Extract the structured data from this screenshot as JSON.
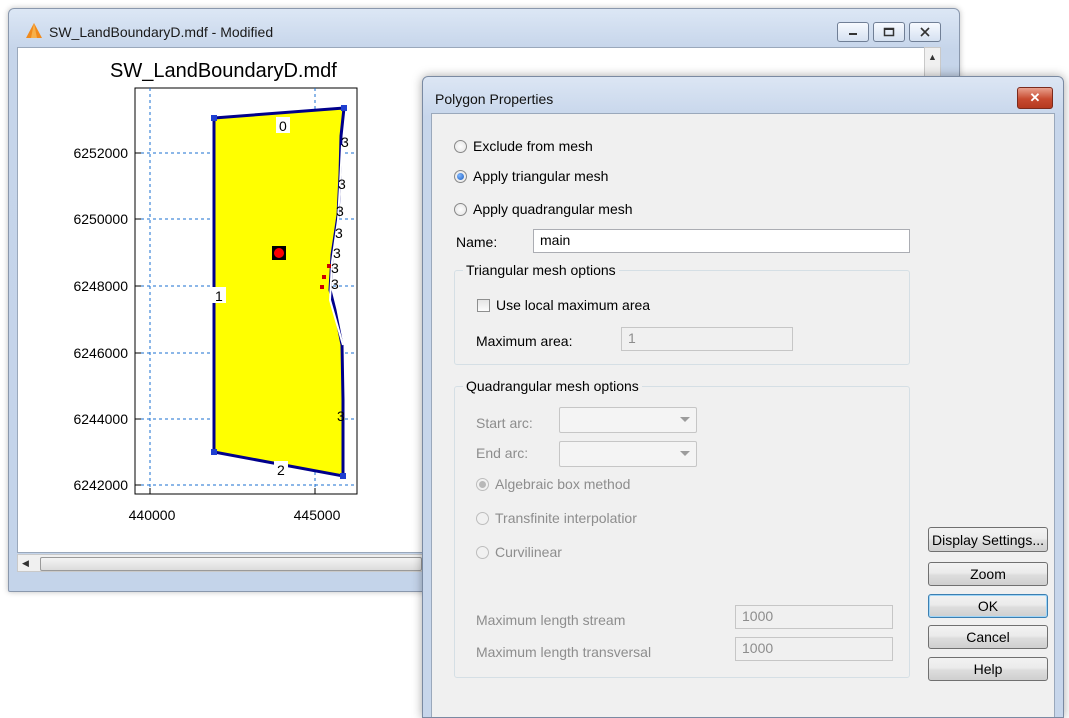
{
  "main_window": {
    "title": "SW_LandBoundaryD.mdf - Modified",
    "min_icon": "minimize-icon",
    "max_icon": "maximize-icon",
    "close_icon": "close-icon"
  },
  "plot": {
    "title": "SW_LandBoundaryD.mdf",
    "y_ticks": [
      "6252000",
      "6250000",
      "6248000",
      "6246000",
      "6244000",
      "6242000"
    ],
    "x_ticks": [
      "440000",
      "445000"
    ],
    "arc_labels": {
      "top": "0",
      "left": "1",
      "bottom": "2",
      "right": [
        "3",
        "3",
        "3",
        "3",
        "3",
        "3",
        "3"
      ],
      "right_low": "3"
    },
    "colors": {
      "polygon_fill": "#ffff00",
      "boundary": "#000099",
      "grid": "#0066cc",
      "marker": "#ff0000"
    }
  },
  "dialog": {
    "title": "Polygon Properties",
    "close_label": "✕",
    "radio_exclude": "Exclude from mesh",
    "radio_triangular": "Apply triangular mesh",
    "radio_quadrangular": "Apply quadrangular mesh",
    "name_label": "Name:",
    "name_value": "main",
    "tri_group_title": "Triangular mesh options",
    "use_local_max_area": "Use local maximum area",
    "max_area_label": "Maximum area:",
    "max_area_value": "1",
    "quad_group_title": "Quadrangular mesh options",
    "start_arc_label": "Start arc:",
    "end_arc_label": "End arc:",
    "radio_algebraic": "Algebraic box method",
    "radio_transfinite": "Transfinite interpolatior",
    "radio_curvilinear": "Curvilinear",
    "max_len_stream_label": "Maximum length stream",
    "max_len_stream_value": "1000",
    "max_len_trans_label": "Maximum length transversal",
    "max_len_trans_value": "1000",
    "buttons": {
      "display_settings": "Display Settings...",
      "zoom": "Zoom",
      "ok": "OK",
      "cancel": "Cancel",
      "help": "Help"
    }
  }
}
